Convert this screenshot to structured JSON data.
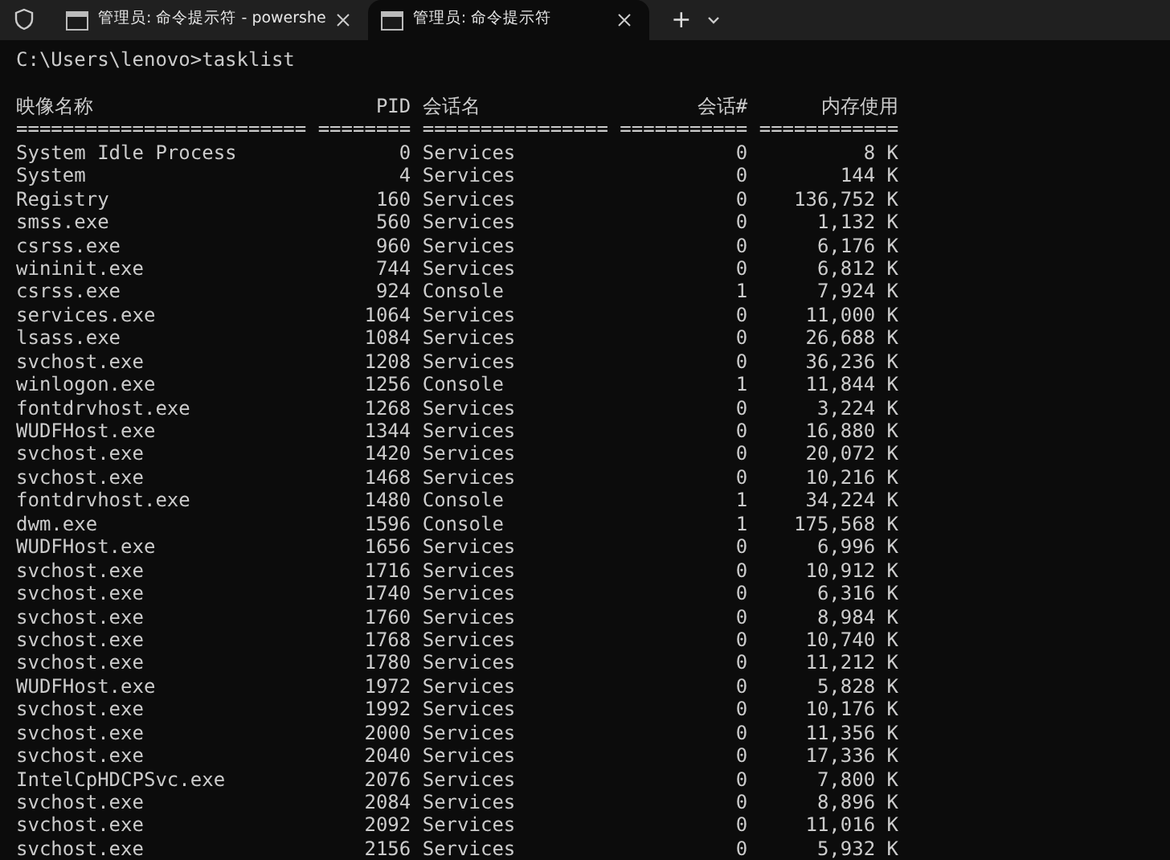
{
  "tabs": [
    {
      "title": "管理员: 命令提示符 - powershe",
      "selected": false
    },
    {
      "title": "管理员: 命令提示符",
      "selected": true
    }
  ],
  "new_tab_button": "+",
  "prompt": "C:\\Users\\lenovo>tasklist",
  "table": {
    "columns": [
      "映像名称",
      "PID",
      "会话名",
      "会话#",
      "内存使用"
    ],
    "separators": [
      "=========================",
      "========",
      "================",
      "===========",
      "============"
    ],
    "rows": [
      [
        "System Idle Process",
        "0",
        "Services",
        "0",
        "8 K"
      ],
      [
        "System",
        "4",
        "Services",
        "0",
        "144 K"
      ],
      [
        "Registry",
        "160",
        "Services",
        "0",
        "136,752 K"
      ],
      [
        "smss.exe",
        "560",
        "Services",
        "0",
        "1,132 K"
      ],
      [
        "csrss.exe",
        "960",
        "Services",
        "0",
        "6,176 K"
      ],
      [
        "wininit.exe",
        "744",
        "Services",
        "0",
        "6,812 K"
      ],
      [
        "csrss.exe",
        "924",
        "Console",
        "1",
        "7,924 K"
      ],
      [
        "services.exe",
        "1064",
        "Services",
        "0",
        "11,000 K"
      ],
      [
        "lsass.exe",
        "1084",
        "Services",
        "0",
        "26,688 K"
      ],
      [
        "svchost.exe",
        "1208",
        "Services",
        "0",
        "36,236 K"
      ],
      [
        "winlogon.exe",
        "1256",
        "Console",
        "1",
        "11,844 K"
      ],
      [
        "fontdrvhost.exe",
        "1268",
        "Services",
        "0",
        "3,224 K"
      ],
      [
        "WUDFHost.exe",
        "1344",
        "Services",
        "0",
        "16,880 K"
      ],
      [
        "svchost.exe",
        "1420",
        "Services",
        "0",
        "20,072 K"
      ],
      [
        "svchost.exe",
        "1468",
        "Services",
        "0",
        "10,216 K"
      ],
      [
        "fontdrvhost.exe",
        "1480",
        "Console",
        "1",
        "34,224 K"
      ],
      [
        "dwm.exe",
        "1596",
        "Console",
        "1",
        "175,568 K"
      ],
      [
        "WUDFHost.exe",
        "1656",
        "Services",
        "0",
        "6,996 K"
      ],
      [
        "svchost.exe",
        "1716",
        "Services",
        "0",
        "10,912 K"
      ],
      [
        "svchost.exe",
        "1740",
        "Services",
        "0",
        "6,316 K"
      ],
      [
        "svchost.exe",
        "1760",
        "Services",
        "0",
        "8,984 K"
      ],
      [
        "svchost.exe",
        "1768",
        "Services",
        "0",
        "10,740 K"
      ],
      [
        "svchost.exe",
        "1780",
        "Services",
        "0",
        "11,212 K"
      ],
      [
        "WUDFHost.exe",
        "1972",
        "Services",
        "0",
        "5,828 K"
      ],
      [
        "svchost.exe",
        "1992",
        "Services",
        "0",
        "10,176 K"
      ],
      [
        "svchost.exe",
        "2000",
        "Services",
        "0",
        "11,356 K"
      ],
      [
        "svchost.exe",
        "2040",
        "Services",
        "0",
        "17,336 K"
      ],
      [
        "IntelCpHDCPSvc.exe",
        "2076",
        "Services",
        "0",
        "7,800 K"
      ],
      [
        "svchost.exe",
        "2084",
        "Services",
        "0",
        "8,896 K"
      ],
      [
        "svchost.exe",
        "2092",
        "Services",
        "0",
        "11,016 K"
      ],
      [
        "svchost.exe",
        "2156",
        "Services",
        "0",
        "5,932 K"
      ]
    ]
  }
}
